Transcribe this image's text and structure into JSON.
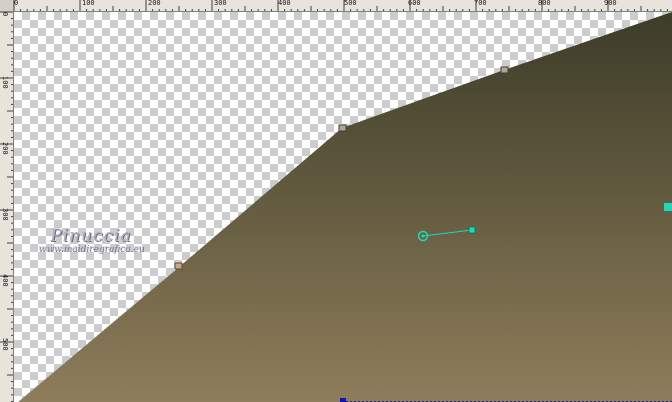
{
  "ruler": {
    "top_ticks": [
      "0",
      "100",
      "200",
      "300",
      "400",
      "500",
      "600",
      "700",
      "800",
      "900"
    ],
    "left_ticks": [
      "0",
      "100",
      "200",
      "300",
      "400",
      "500"
    ]
  },
  "watermark": {
    "title": "Pinuccia",
    "url": "www.maidiregrafica.eu"
  },
  "colors": {
    "gradient_top": "#3c3c28",
    "gradient_bottom": "#8e7d5a",
    "handle_color": "#20d8b8",
    "node_color": "#a09070"
  }
}
